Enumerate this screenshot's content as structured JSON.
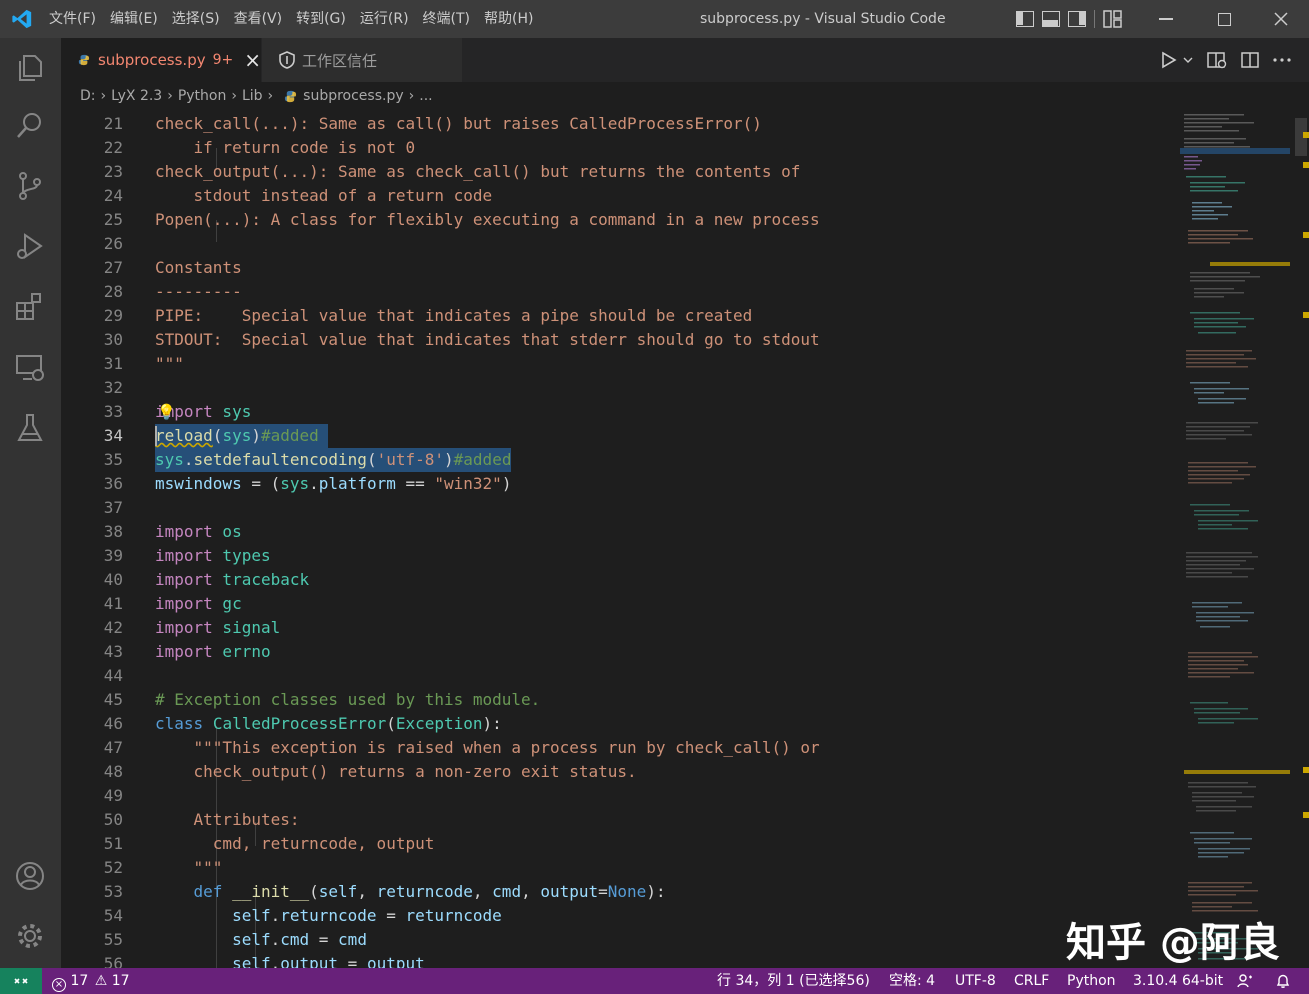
{
  "titlebar": {
    "menu": [
      "文件(F)",
      "编辑(E)",
      "选择(S)",
      "查看(V)",
      "转到(G)",
      "运行(R)",
      "终端(T)",
      "帮助(H)"
    ],
    "window_title": "subprocess.py - Visual Studio Code"
  },
  "tabs": [
    {
      "label": "subprocess.py",
      "badge": "9+",
      "close": "×"
    },
    {
      "label": "工作区信任"
    }
  ],
  "breadcrumb": [
    "D:",
    "LyX 2.3",
    "Python",
    "Lib",
    "subprocess.py",
    "..."
  ],
  "code_lines": [
    {
      "n": "21",
      "t": "check_call(...): Same as call() but raises CalledProcessError()"
    },
    {
      "n": "22",
      "t": "    if return code is not 0"
    },
    {
      "n": "23",
      "t": "check_output(...): Same as check_call() but returns the contents of"
    },
    {
      "n": "24",
      "t": "    stdout instead of a return code"
    },
    {
      "n": "25",
      "t": "Popen(...): A class for flexibly executing a command in a new process"
    },
    {
      "n": "26",
      "t": ""
    },
    {
      "n": "27",
      "t": "Constants"
    },
    {
      "n": "28",
      "t": "---------"
    },
    {
      "n": "29",
      "t": "PIPE:    Special value that indicates a pipe should be created"
    },
    {
      "n": "30",
      "t": "STDOUT:  Special value that indicates that stderr should go to stdout"
    },
    {
      "n": "31",
      "t": "\"\"\""
    },
    {
      "n": "32",
      "t": ""
    },
    {
      "n": "33",
      "a": "import",
      "b": " sys"
    },
    {
      "n": "34",
      "a": "reload",
      "b": "(",
      "c": "sys",
      "d": ")",
      "e": "#added"
    },
    {
      "n": "35",
      "a": "sys",
      "b": ".",
      "c": "setdefaultencoding",
      "d": "(",
      "e": "'utf-8'",
      "f": ")",
      "g": "#added"
    },
    {
      "n": "36",
      "a": "mswindows",
      "b": " = (",
      "c": "sys",
      "d": ".",
      "e": "platform",
      "f": " == ",
      "g": "\"win32\"",
      "h": ")"
    },
    {
      "n": "37",
      "t": ""
    },
    {
      "n": "38",
      "a": "import",
      "b": " os"
    },
    {
      "n": "39",
      "a": "import",
      "b": " types"
    },
    {
      "n": "40",
      "a": "import",
      "b": " traceback"
    },
    {
      "n": "41",
      "a": "import",
      "b": " gc"
    },
    {
      "n": "42",
      "a": "import",
      "b": " signal"
    },
    {
      "n": "43",
      "a": "import",
      "b": " errno"
    },
    {
      "n": "44",
      "t": ""
    },
    {
      "n": "45",
      "t": "# Exception classes used by this module."
    },
    {
      "n": "46",
      "a": "class",
      "b": " ",
      "c": "CalledProcessError",
      "d": "(",
      "e": "Exception",
      "f": "):"
    },
    {
      "n": "47",
      "t": "    \"\"\"This exception is raised when a process run by check_call() or"
    },
    {
      "n": "48",
      "t": "    check_output() returns a non-zero exit status."
    },
    {
      "n": "49",
      "t": ""
    },
    {
      "n": "50",
      "t": "    Attributes:"
    },
    {
      "n": "51",
      "t": "      cmd, returncode, output"
    },
    {
      "n": "52",
      "t": "    \"\"\""
    },
    {
      "n": "53",
      "a": "    def",
      "b": " ",
      "c": "__init__",
      "d": "(",
      "e": "self",
      "f": ", ",
      "g": "returncode",
      "h": ", ",
      "i": "cmd",
      "j": ", ",
      "k": "output",
      "l": "=",
      "m": "None",
      "o": "):"
    },
    {
      "n": "54",
      "a": "        self",
      "b": ".",
      "c": "returncode",
      "d": " = ",
      "e": "returncode"
    },
    {
      "n": "55",
      "a": "        self",
      "b": ".",
      "c": "cmd",
      "d": " = ",
      "e": "cmd"
    },
    {
      "n": "56",
      "a": "        self",
      "b": ".",
      "c": "output",
      "d": " = ",
      "e": "output"
    }
  ],
  "statusbar": {
    "errors": "17",
    "warnings": "17",
    "position": "行 34，列 1 (已选择56)",
    "spaces": "空格: 4",
    "encoding": "UTF-8",
    "eol": "CRLF",
    "language": "Python",
    "interpreter": "3.10.4 64-bit"
  },
  "watermark": "知乎 @阿良",
  "colors": {
    "statusbar": "#68217a",
    "remote": "#16825d",
    "selection": "#264f78"
  }
}
